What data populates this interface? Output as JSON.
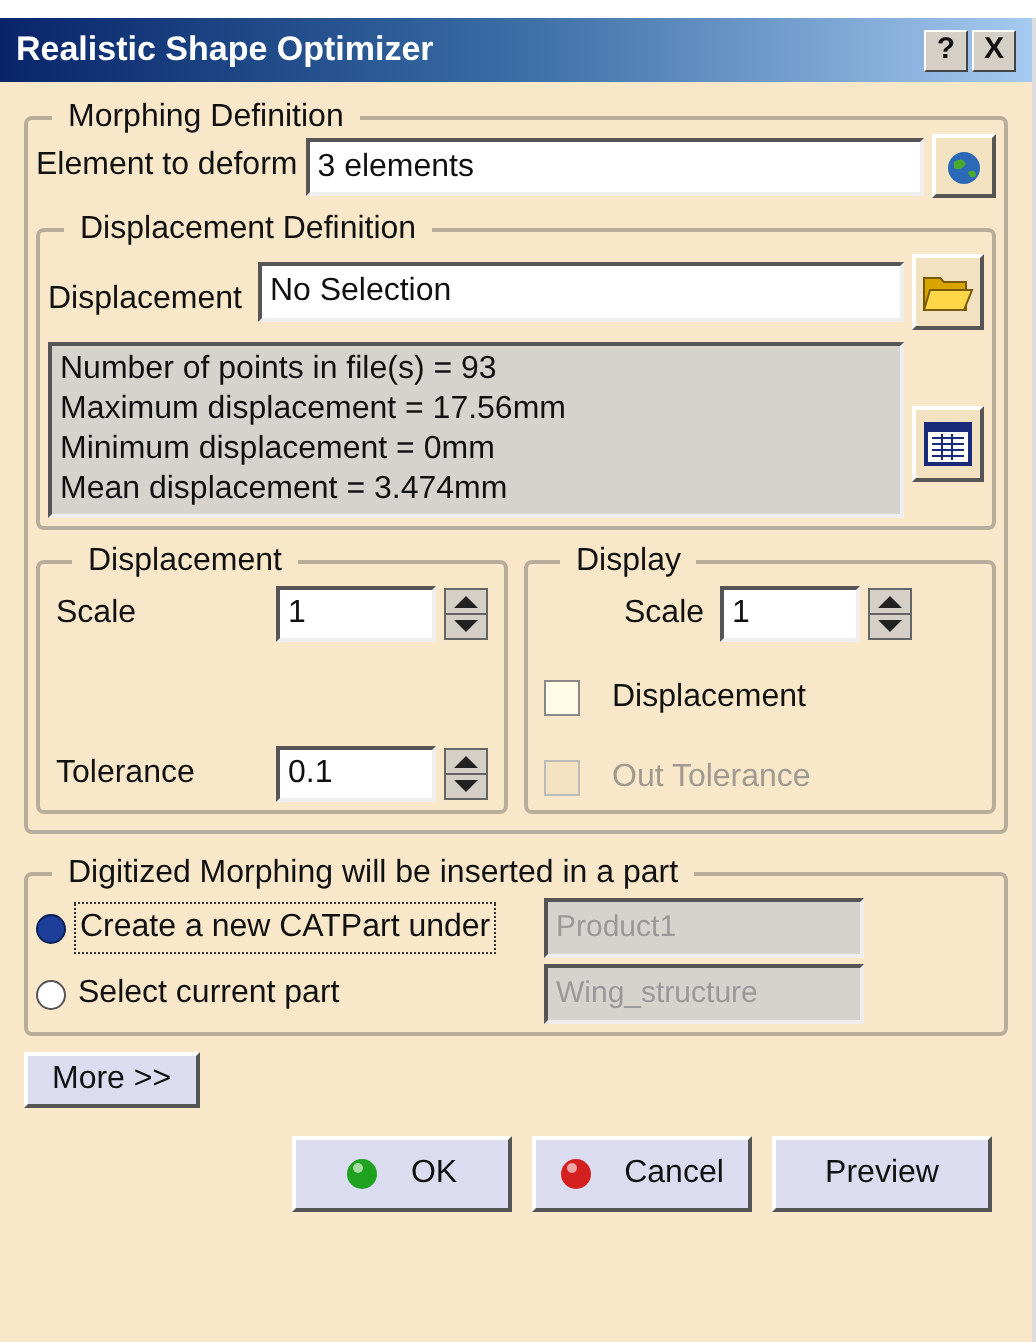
{
  "window": {
    "title": "Realistic Shape Optimizer",
    "title_buttons": [
      "?",
      "X"
    ]
  },
  "morphing": {
    "legend": "Morphing Definition",
    "element_label": "Element to deform",
    "element_value": "3 elements"
  },
  "displacement_definition": {
    "legend": "Displacement Definition",
    "label": "Displacement",
    "value": "No Selection",
    "info": [
      "Number of points in file(s) = 93",
      "Maximum displacement = 17.56mm",
      "Minimum displacement = 0mm",
      "Mean displacement = 3.474mm"
    ]
  },
  "displacement_group": {
    "legend": "Displacement",
    "fields": [
      {
        "label": "Scale",
        "value": "1"
      },
      {
        "label": "Tolerance",
        "value": "0.1"
      }
    ]
  },
  "display_group": {
    "legend": "Display",
    "scale": {
      "label": "Scale",
      "value": "1"
    },
    "options": [
      {
        "label": "Displacement",
        "checked": false,
        "disabled": false
      },
      {
        "label": "Out Tolerance",
        "checked": false,
        "disabled": true
      }
    ]
  },
  "insert_group": {
    "legend": "Digitized Morphing will be inserted in a part",
    "options": [
      {
        "label": "Create a new CATPart under",
        "selected": true,
        "field": "Product1"
      },
      {
        "label": "Select current part",
        "selected": false,
        "field": "Wing_structure"
      }
    ]
  },
  "more_button": "More >>",
  "buttons": [
    {
      "label": "OK",
      "kind": "ok"
    },
    {
      "label": "Cancel",
      "kind": "cancel"
    },
    {
      "label": "Preview",
      "kind": "plain"
    }
  ]
}
